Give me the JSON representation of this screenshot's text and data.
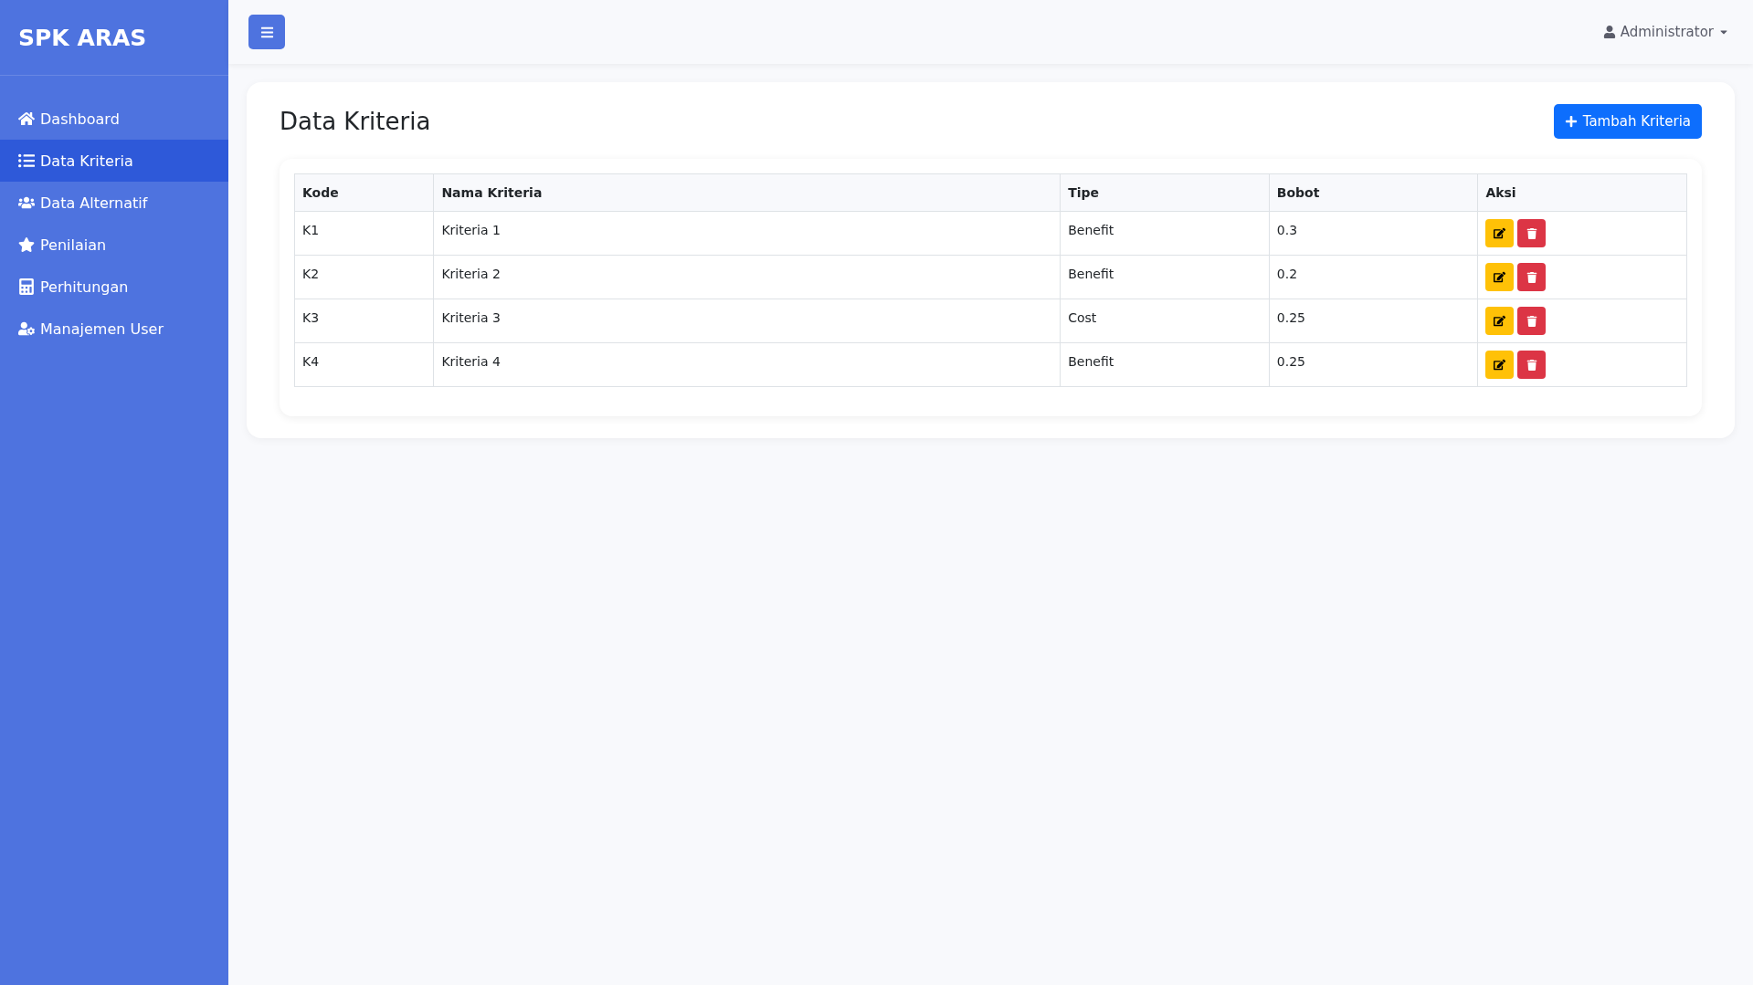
{
  "brand": "SPK ARAS",
  "sidebar": {
    "items": [
      {
        "label": "Dashboard",
        "selected": false
      },
      {
        "label": "Data Kriteria",
        "selected": true
      },
      {
        "label": "Data Alternatif",
        "selected": false
      },
      {
        "label": "Penilaian",
        "selected": false
      },
      {
        "label": "Perhitungan",
        "selected": false
      },
      {
        "label": "Manajemen User",
        "selected": false
      }
    ]
  },
  "topbar": {
    "user": "Administrator"
  },
  "page": {
    "title": "Data Kriteria",
    "add_button": "Tambah Kriteria"
  },
  "table": {
    "columns": [
      "Kode",
      "Nama Kriteria",
      "Tipe",
      "Bobot",
      "Aksi"
    ],
    "rows": [
      {
        "cells": [
          "K1",
          "Kriteria 1",
          "Benefit",
          "0.3"
        ]
      },
      {
        "cells": [
          "K2",
          "Kriteria 2",
          "Benefit",
          "0.2"
        ]
      },
      {
        "cells": [
          "K3",
          "Kriteria 3",
          "Cost",
          "0.25"
        ]
      },
      {
        "cells": [
          "K4",
          "Kriteria 4",
          "Benefit",
          "0.25"
        ]
      }
    ]
  }
}
